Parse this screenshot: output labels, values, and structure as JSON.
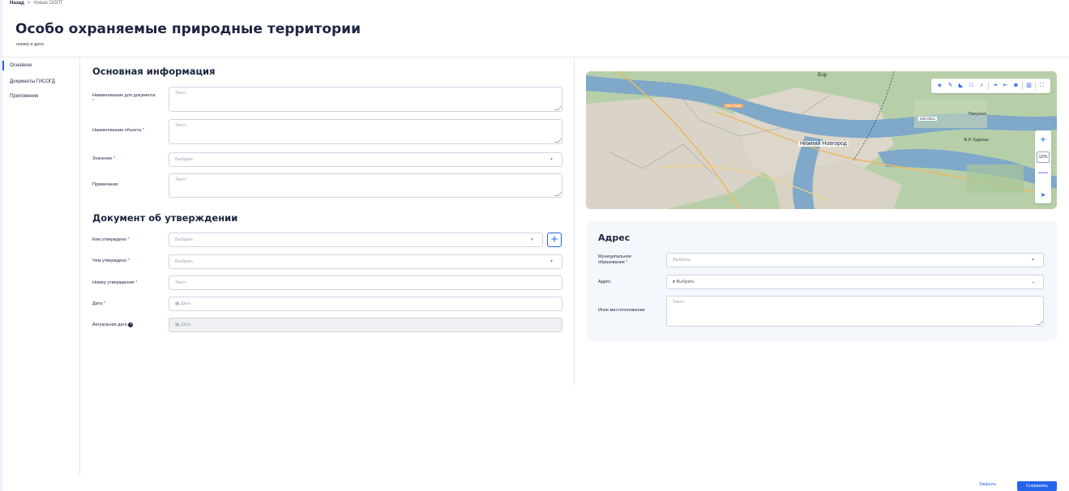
{
  "breadcrumb": {
    "back": "Назад",
    "separator": ">",
    "current": "Новая ООПТ"
  },
  "page": {
    "title": "Особо охраняемые природные территории",
    "subtitle": "номер и дата"
  },
  "sidenav": {
    "items": [
      {
        "label": "Основное",
        "active": true
      },
      {
        "label": "Документы ГИСОГД",
        "active": false
      },
      {
        "label": "Приложения",
        "active": false
      }
    ]
  },
  "main_info": {
    "title": "Основная информация",
    "doc_name_label": "Наименование для документа",
    "doc_name_placeholder": "Текст",
    "object_name_label": "Наименование объекта",
    "object_name_placeholder": "Текст",
    "value_label": "Значение",
    "value_placeholder": "Выбрать",
    "notes_label": "Примечания",
    "notes_placeholder": "Текст"
  },
  "approval": {
    "title": "Документ об утверждении",
    "by_whom_label": "Кем утверждено",
    "by_whom_placeholder": "Выбрать",
    "by_what_label": "Чем утверждено",
    "by_what_placeholder": "Выбрать",
    "number_label": "Номер утверждения",
    "number_placeholder": "Текст",
    "date_label": "Дата",
    "date_placeholder": "Дата",
    "actual_date_label": "Актуальная дата",
    "actual_date_placeholder": "Дата"
  },
  "map": {
    "city_label": "Нижний Новгород",
    "place_bor": "Бор",
    "place_pavlovo": "Панутино",
    "place_zadolye": "Ж.Р. Задолье",
    "road_1": "22Р-0159",
    "road_2": "22К-0021",
    "zoom_level": "12%",
    "icons": [
      "layers-icon",
      "pencil-icon",
      "ruler-icon",
      "square-icon",
      "search-icon",
      "import-icon",
      "export-icon",
      "camera-icon",
      "trash-icon",
      "fullscreen-icon"
    ]
  },
  "address": {
    "title": "Адрес",
    "municipality_label": "Муниципальное образование",
    "municipality_placeholder": "Выбрать",
    "address_label": "Адрес",
    "address_placeholder": "Выбрать",
    "other_location_label": "Иное местоположение",
    "other_location_placeholder": "Текст"
  },
  "footer": {
    "close_label": "Закрыть",
    "save_label": "Сохранить"
  },
  "colors": {
    "accent": "#2563eb",
    "required": "#e11d48",
    "title": "#1b2540"
  }
}
